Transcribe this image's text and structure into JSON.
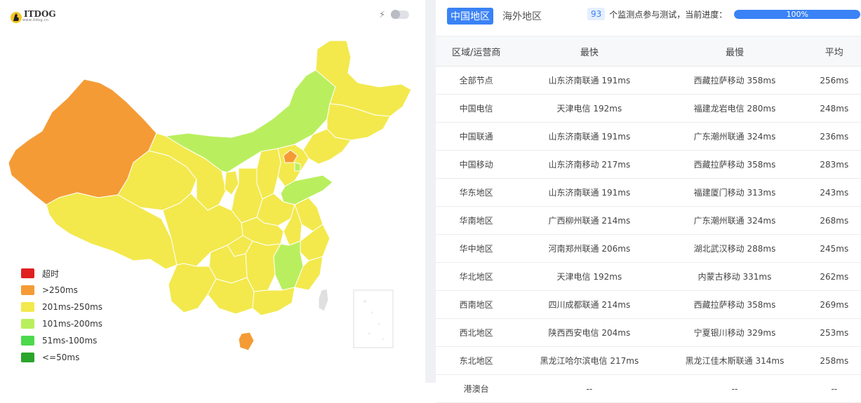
{
  "brand": {
    "name": "ITDOG",
    "subtitle": "www.itdog.cn"
  },
  "controls": {
    "toggle_state": "off"
  },
  "legend": [
    {
      "label": "超时",
      "color": "#e02020"
    },
    {
      "label": ">250ms",
      "color": "#f59b35"
    },
    {
      "label": "201ms-250ms",
      "color": "#f3e94d"
    },
    {
      "label": "101ms-200ms",
      "color": "#b9ef5e"
    },
    {
      "label": "51ms-100ms",
      "color": "#4cd94c"
    },
    {
      "label": "<=50ms",
      "color": "#2aa52a"
    }
  ],
  "tabs": [
    {
      "label": "中国地区",
      "active": true
    },
    {
      "label": "海外地区",
      "active": false
    }
  ],
  "progress": {
    "count": "93",
    "text": "个监测点参与测试，当前进度：",
    "value_label": "100%",
    "fraction": 1.0
  },
  "table": {
    "headers": [
      "区域/运营商",
      "最快",
      "最慢",
      "平均"
    ],
    "rows": [
      [
        "全部节点",
        "山东济南联通 191ms",
        "西藏拉萨移动 358ms",
        "256ms"
      ],
      [
        "中国电信",
        "天津电信 192ms",
        "福建龙岩电信 280ms",
        "248ms"
      ],
      [
        "中国联通",
        "山东济南联通 191ms",
        "广东潮州联通 324ms",
        "236ms"
      ],
      [
        "中国移动",
        "山东济南移动 217ms",
        "西藏拉萨移动 358ms",
        "283ms"
      ],
      [
        "华东地区",
        "山东济南联通 191ms",
        "福建厦门移动 313ms",
        "243ms"
      ],
      [
        "华南地区",
        "广西柳州联通 214ms",
        "广东潮州联通 324ms",
        "268ms"
      ],
      [
        "华中地区",
        "河南郑州联通 206ms",
        "湖北武汉移动 288ms",
        "245ms"
      ],
      [
        "华北地区",
        "天津电信 192ms",
        "内蒙古移动 331ms",
        "262ms"
      ],
      [
        "西南地区",
        "四川成都联通 214ms",
        "西藏拉萨移动 358ms",
        "269ms"
      ],
      [
        "西北地区",
        "陕西西安电信 204ms",
        "宁夏银川移动 329ms",
        "253ms"
      ],
      [
        "东北地区",
        "黑龙江哈尔滨电信 217ms",
        "黑龙江佳木斯联通 314ms",
        "258ms"
      ],
      [
        "港澳台",
        "--",
        "--",
        "--"
      ]
    ]
  },
  "colors": {
    "accent": "#3a82f6",
    "over250": "#f59b35",
    "r201_250": "#f3e94d",
    "r101_200": "#b9ef5e"
  }
}
